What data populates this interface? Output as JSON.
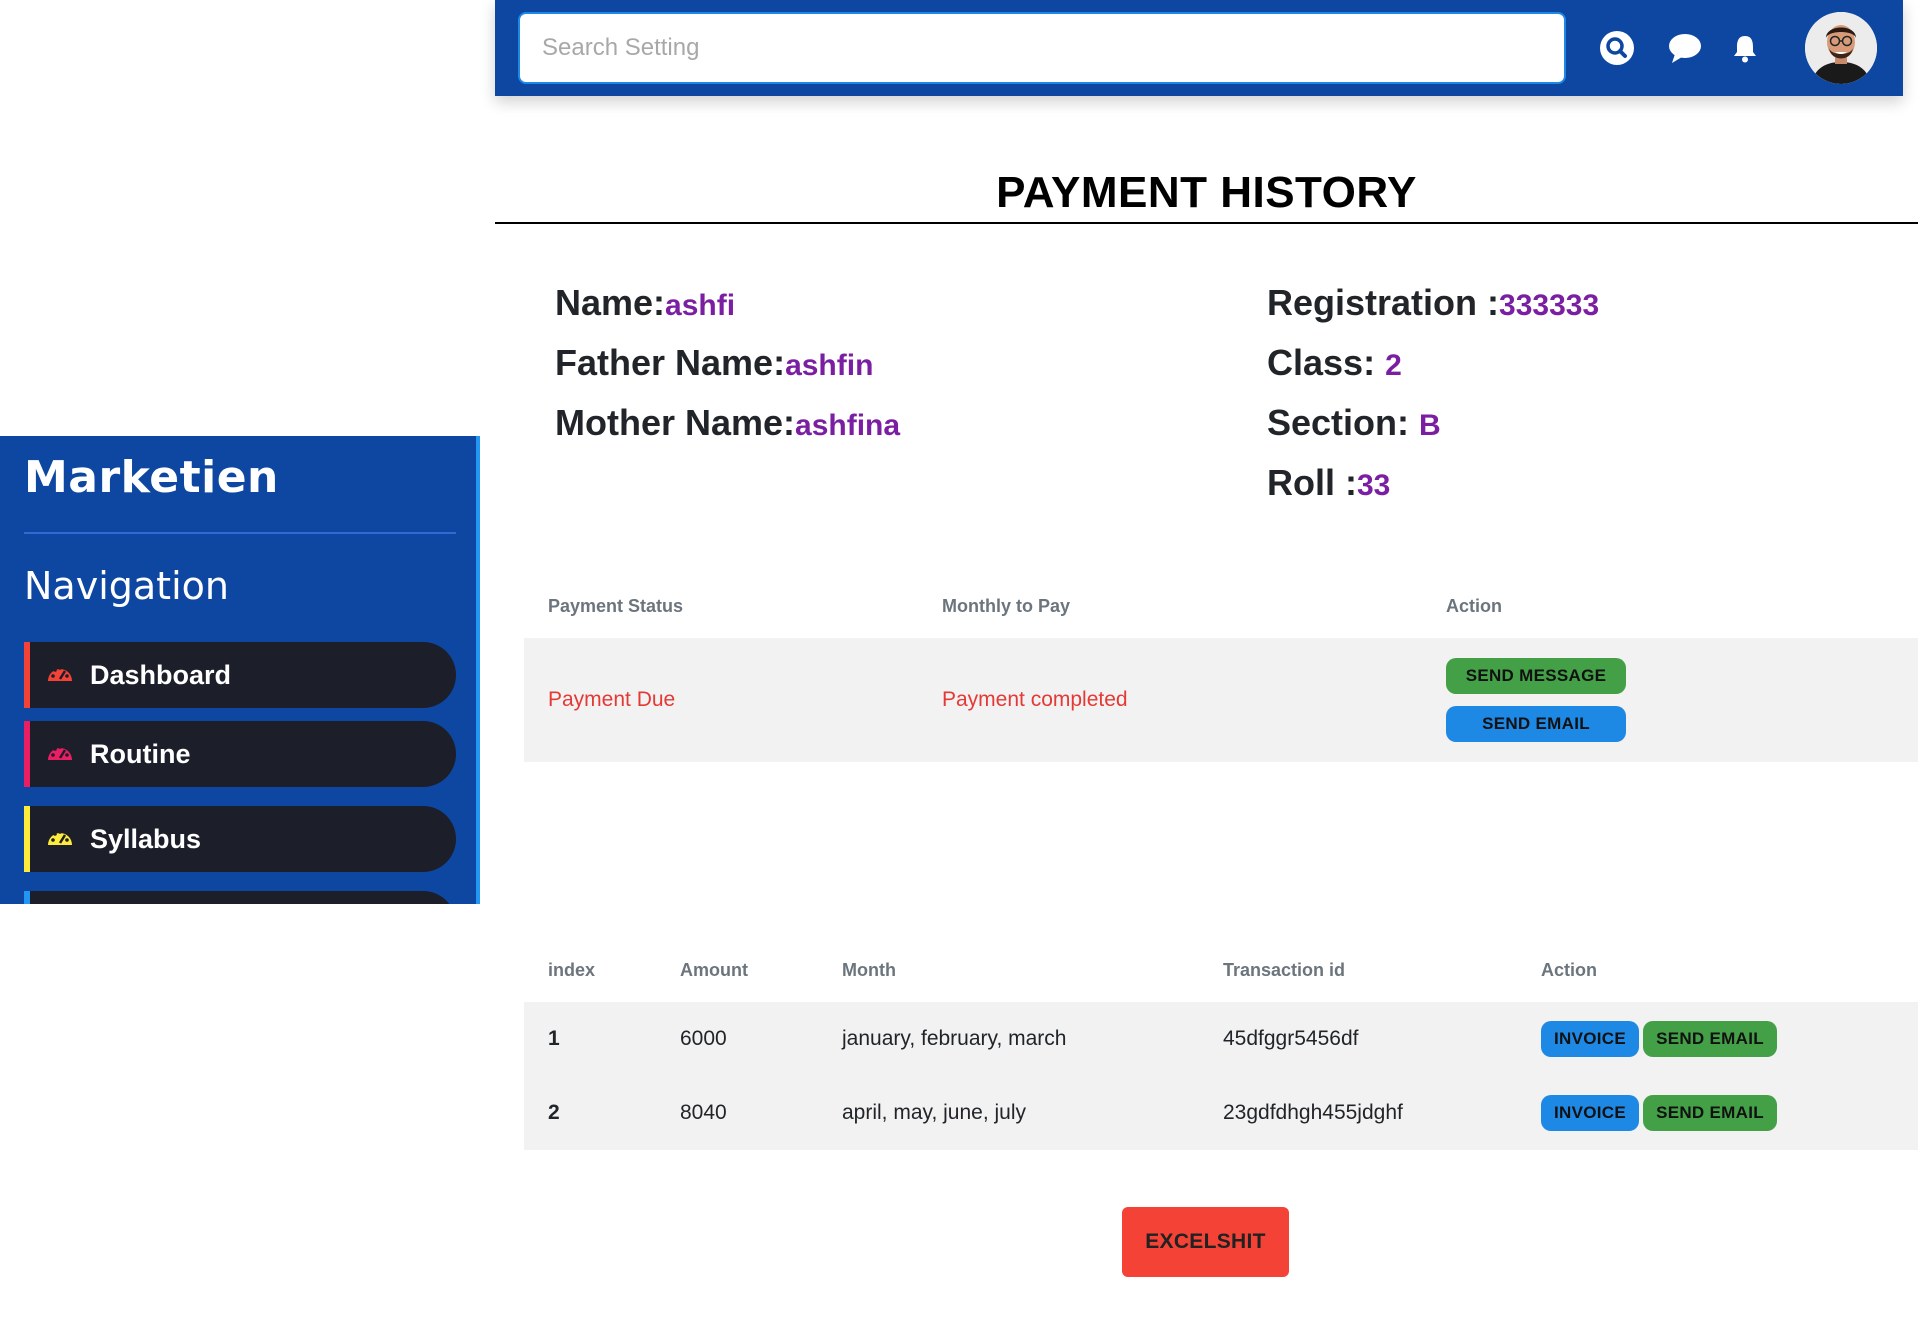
{
  "header": {
    "search_placeholder": "Search Setting",
    "icons": [
      "search-icon",
      "chat-icon",
      "bell-icon",
      "avatar"
    ]
  },
  "sidebar": {
    "logo": "Marketien",
    "nav_title": "Navigation",
    "items": [
      {
        "label": "Dashboard",
        "icon": "dashboard-icon",
        "accent": "#f44336"
      },
      {
        "label": "Routine",
        "icon": "dashboard-icon",
        "accent": "#e91e63"
      },
      {
        "label": "Syllabus",
        "icon": "dashboard-icon",
        "accent": "#ffeb3b"
      }
    ]
  },
  "page": {
    "title": "PAYMENT HISTORY"
  },
  "student": {
    "name_label": "Name:",
    "name": "ashfi",
    "father_label": "Father Name:",
    "father": "ashfin",
    "mother_label": "Mother Name:",
    "mother": "ashfina",
    "registration_label": "Registration :",
    "registration": "333333",
    "class_label": "Class: ",
    "class": "2",
    "section_label": "Section: ",
    "section": "B",
    "roll_label": "Roll :",
    "roll": "33"
  },
  "status_table": {
    "headers": [
      "Payment Status",
      "Monthly to Pay",
      "Action"
    ],
    "row": {
      "payment_status": "Payment Due",
      "monthly_to_pay": "Payment completed",
      "send_message": "SEND MESSAGE",
      "send_email": "SEND EMAIL"
    }
  },
  "payments_table": {
    "headers": [
      "index",
      "Amount",
      "Month",
      "Transaction id",
      "Action"
    ],
    "rows": [
      {
        "index": "1",
        "amount": "6000",
        "month": "january, february, march",
        "transaction_id": "45dfggr5456df",
        "invoice": "INVOICE",
        "send_email": "SEND EMAIL"
      },
      {
        "index": "2",
        "amount": "8040",
        "month": "april, may, june, july",
        "transaction_id": "23gdfdhgh455jdghf",
        "invoice": "INVOICE",
        "send_email": "SEND EMAIL"
      }
    ]
  },
  "export_button": "EXCELSHIT",
  "colors": {
    "primary": "#0d47a1",
    "value_purple": "#7b1fa2",
    "danger": "#f44336",
    "success": "#43a047",
    "info": "#1e88e5"
  }
}
